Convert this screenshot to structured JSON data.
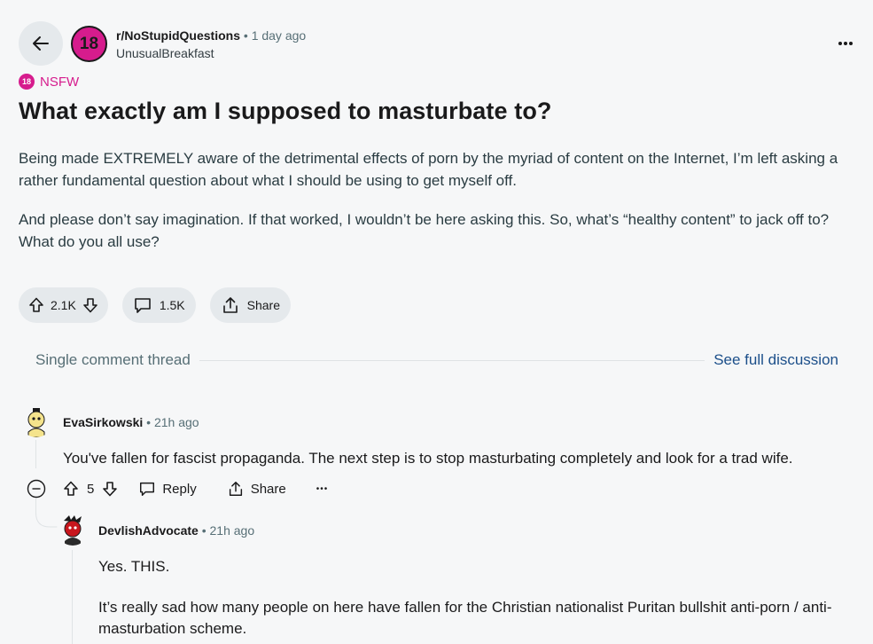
{
  "post": {
    "subreddit": "r/NoStupidQuestions",
    "subreddit_avatar_text": "18",
    "dot": "•",
    "time": "1 day ago",
    "author": "UnusualBreakfast",
    "nsfw_badge": "18",
    "nsfw_label": "NSFW",
    "title": "What exactly am I supposed to masturbate to?",
    "body": [
      "Being made EXTREMELY aware of the detrimental effects of porn by the myriad of content on the Internet, I’m left asking a rather fundamental question about what I should be using to get myself off.",
      "And please don’t say imagination. If that worked, I wouldn’t be here asking this. So, what’s “healthy content” to jack off to? What do you all use?"
    ],
    "upvotes": "2.1K",
    "comments": "1.5K",
    "share_label": "Share"
  },
  "thread": {
    "label": "Single comment thread",
    "see_full": "See full discussion"
  },
  "comments": [
    {
      "username": "EvaSirkowski",
      "dot": "•",
      "time": "21h ago",
      "text": "You've fallen for fascist propaganda. The next step is to stop masturbating completely and look for a trad wife.",
      "score": "5",
      "reply_label": "Reply",
      "share_label": "Share",
      "more_label": "•••"
    },
    {
      "username": "DevlishAdvocate",
      "dot": "•",
      "time": "21h ago",
      "paragraphs": [
        "Yes. THIS.",
        "It’s really sad how many people on here have fallen for the Christian nationalist Puritan bullshit anti-porn / anti-masturbation scheme."
      ]
    }
  ],
  "colors": {
    "nsfw": "#d61c8d",
    "link": "#1c4f8a",
    "pill_bg": "#e5e9ec",
    "page_bg": "#f6f7f8"
  },
  "icons": [
    "back-arrow-icon",
    "more-options-icon",
    "upvote-icon",
    "downvote-icon",
    "comment-icon",
    "share-icon",
    "collapse-icon"
  ]
}
